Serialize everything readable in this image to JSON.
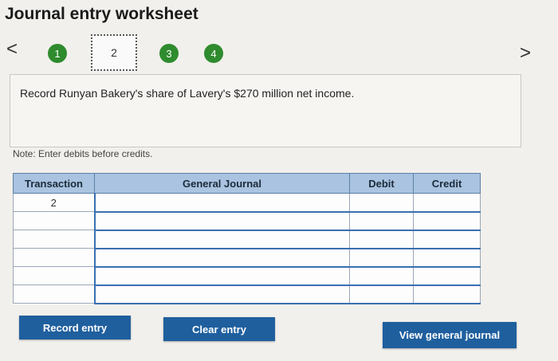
{
  "header": {
    "title": "Journal entry worksheet"
  },
  "nav": {
    "prev_glyph": "<",
    "next_glyph": ">",
    "steps": [
      {
        "label": "1"
      },
      {
        "label": "2"
      },
      {
        "label": "3"
      },
      {
        "label": "4"
      }
    ],
    "current_step": "2"
  },
  "prompt": {
    "text": "Record Runyan Bakery's share of Lavery's $270 million net income."
  },
  "note": "Note: Enter debits before credits.",
  "table": {
    "headers": {
      "transaction": "Transaction",
      "general_journal": "General Journal",
      "debit": "Debit",
      "credit": "Credit"
    },
    "rows": [
      {
        "transaction": "2"
      },
      {
        "transaction": ""
      },
      {
        "transaction": ""
      },
      {
        "transaction": ""
      },
      {
        "transaction": ""
      },
      {
        "transaction": ""
      }
    ]
  },
  "buttons": {
    "record": "Record entry",
    "clear": "Clear entry",
    "view": "View general journal"
  },
  "colors": {
    "step_green": "#2e8b2e",
    "button_blue": "#1f5f9e",
    "header_blue": "#a9c3e0"
  },
  "icons": {
    "prev": "chevron-left-icon",
    "next": "chevron-right-icon"
  }
}
